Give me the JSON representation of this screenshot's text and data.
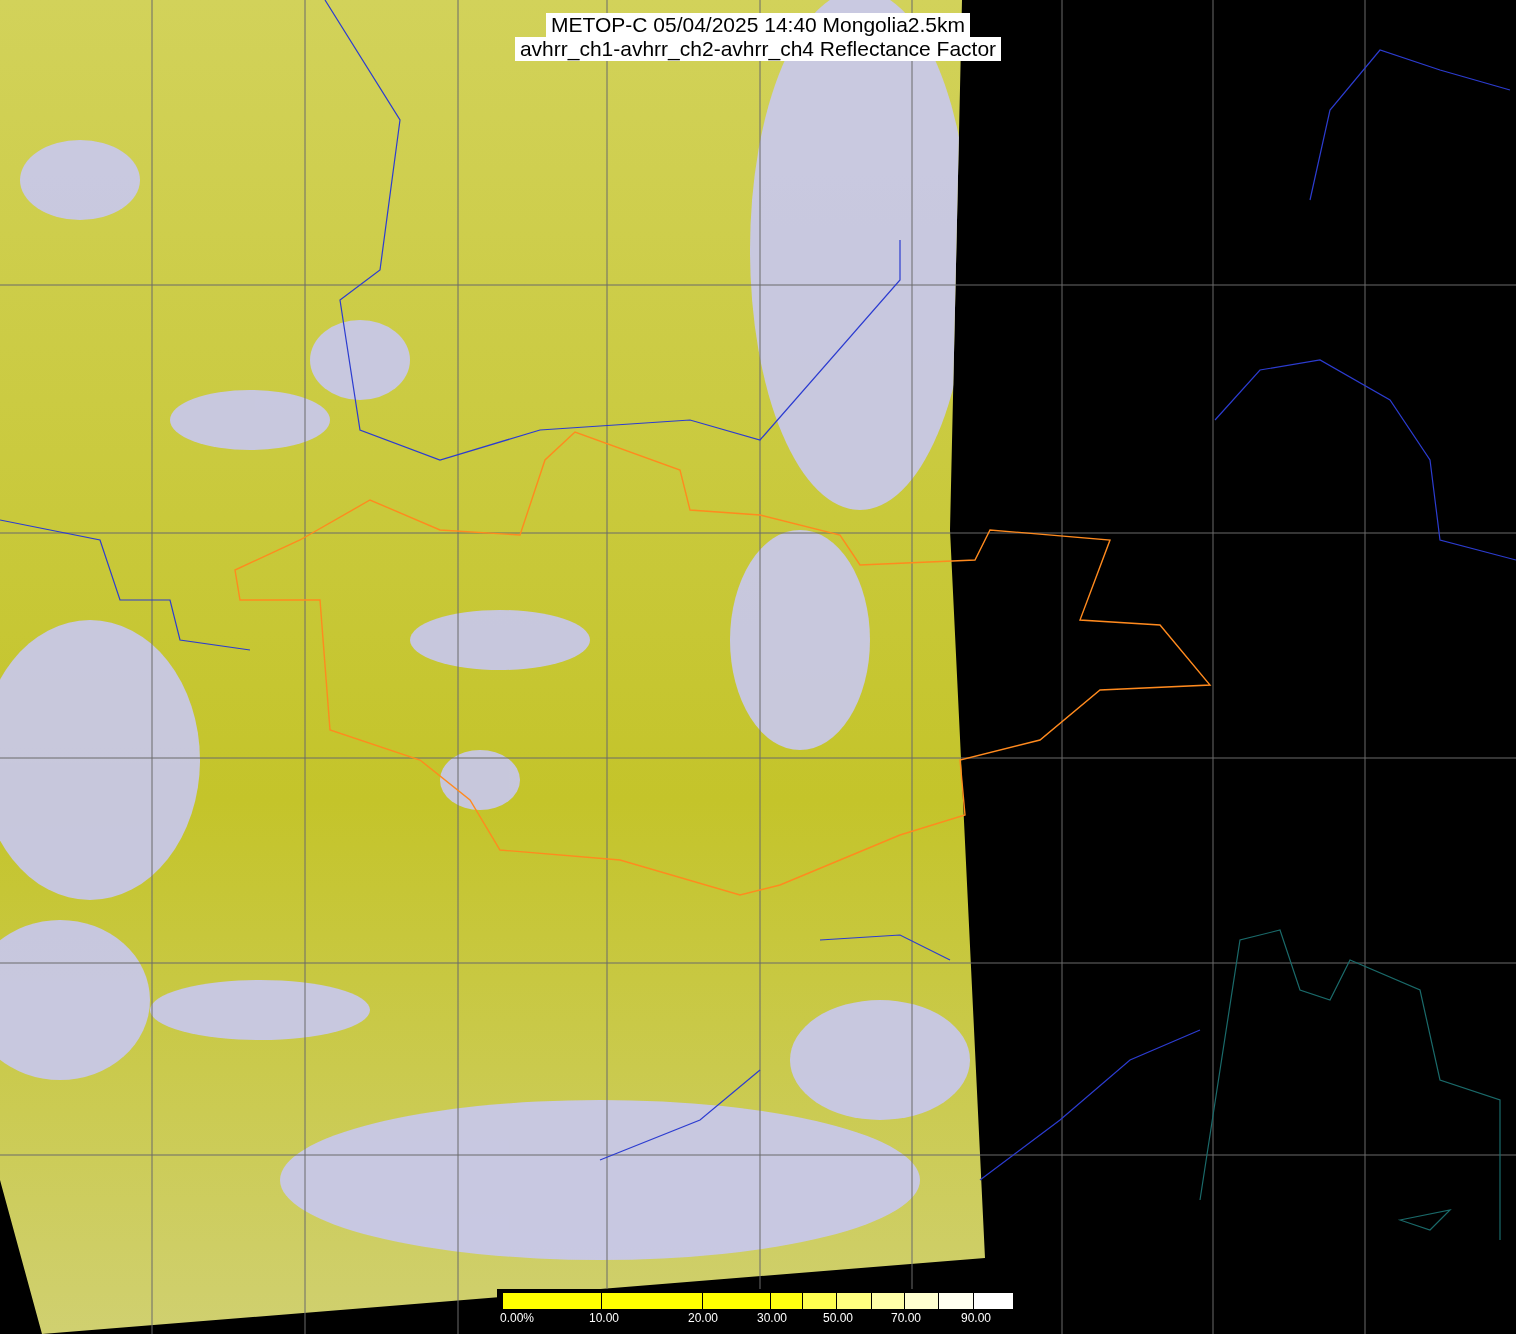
{
  "title": {
    "line_1": "METOP-C 05/04/2025 14:40 Mongolia2.5km",
    "line_2": "avhrr_ch1-avhrr_ch2-avhrr_ch4 Reflectance Factor"
  },
  "colorbar": {
    "segments": [
      {
        "color": "#ffff00"
      },
      {
        "color": "#ffff00"
      },
      {
        "color": "#ffff00"
      },
      {
        "color": "#ffff10"
      },
      {
        "color": "#ffff50"
      },
      {
        "color": "#ffff80"
      },
      {
        "color": "#ffffa8"
      },
      {
        "color": "#ffffd0"
      },
      {
        "color": "#fffff0"
      },
      {
        "color": "#ffffff"
      }
    ],
    "labels": [
      "0.00%",
      "10.00",
      "20.00",
      "30.00",
      "50.00",
      "70.00",
      "90.00"
    ]
  }
}
